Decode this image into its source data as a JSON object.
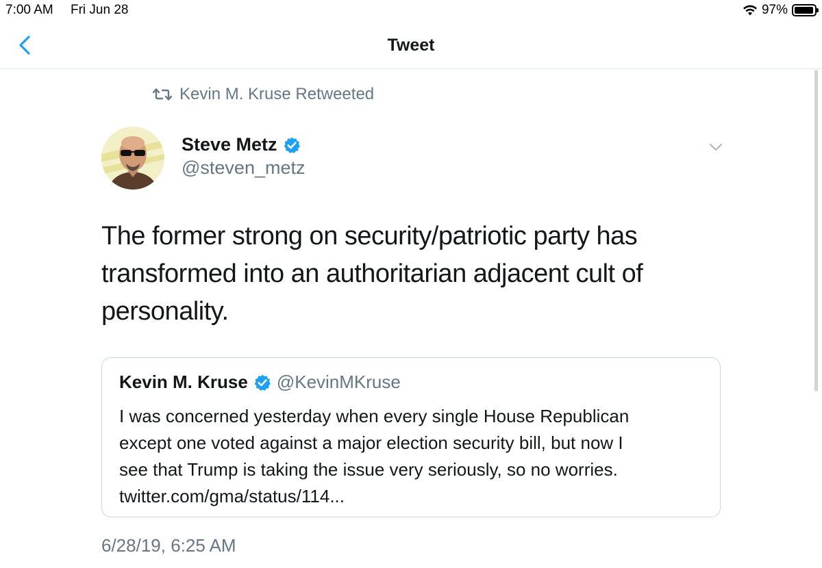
{
  "status_bar": {
    "time": "7:00 AM",
    "date": "Fri Jun 28",
    "battery_percent": "97%",
    "battery_level": 0.97
  },
  "nav": {
    "title": "Tweet",
    "back_icon": "chevron-left-icon"
  },
  "retweet": {
    "label": "Kevin M. Kruse Retweeted",
    "icon": "retweet-icon"
  },
  "tweet": {
    "author_name": "Steve Metz",
    "author_handle": "@steven_metz",
    "verified": true,
    "lines": [
      "The former strong on security/patriotic party has",
      "transformed into an authoritarian adjacent cult of",
      "personality."
    ],
    "timestamp": "6/28/19, 6:25 AM"
  },
  "quoted_tweet": {
    "author_name": "Kevin M. Kruse",
    "author_handle": "@KevinMKruse",
    "verified": true,
    "lines": [
      "I was concerned yesterday when every single House Republican",
      "except one voted against a major election security bill, but now I",
      "see that Trump is taking the issue very seriously, so no worries.",
      "twitter.com/gma/status/114..."
    ]
  },
  "colors": {
    "accent": "#1da1f2",
    "secondary_text": "#657786",
    "primary_text": "#14171a",
    "border": "#ccd6dd"
  }
}
